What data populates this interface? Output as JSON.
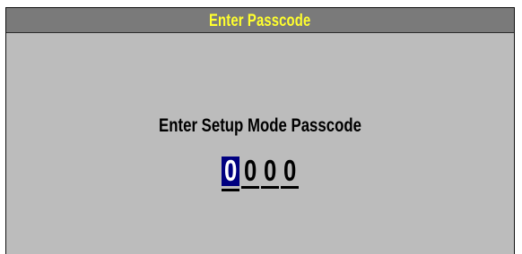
{
  "dialog": {
    "title": "Enter Passcode",
    "prompt": "Enter Setup Mode Passcode",
    "digits": [
      "0",
      "0",
      "0",
      "0"
    ],
    "active_digit_index": 0
  },
  "colors": {
    "title_bar": "#7a7a7a",
    "title_text": "#ffff2e",
    "panel_bg": "#bcbcbc",
    "cursor_highlight": "#000080"
  }
}
